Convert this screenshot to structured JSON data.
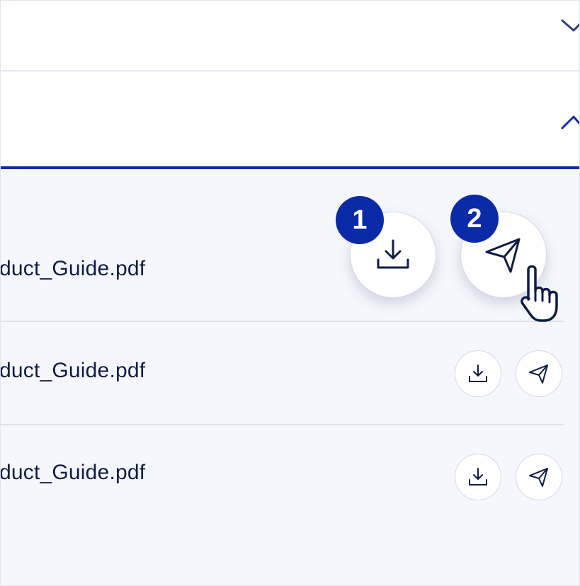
{
  "accordion": {
    "sections": [
      {
        "state": "collapsed",
        "icon": "chevron-down-icon"
      },
      {
        "state": "expanded",
        "icon": "chevron-up-icon"
      }
    ]
  },
  "files": [
    {
      "name": "duct_Guide.pdf",
      "download_icon": "download-icon",
      "send_icon": "send-icon"
    },
    {
      "name": "duct_Guide.pdf",
      "download_icon": "download-icon",
      "send_icon": "send-icon"
    },
    {
      "name": "duct_Guide.pdf",
      "download_icon": "download-icon",
      "send_icon": "send-icon"
    }
  ],
  "steps": [
    {
      "number": "1",
      "target": "download"
    },
    {
      "number": "2",
      "target": "send"
    }
  ],
  "colors": {
    "accent": "#0a2aa8",
    "text": "#0e1c47",
    "content_bg": "#f6f7fd",
    "divider": "#dfe2ec"
  },
  "cursor": {
    "icon": "hand-pointer-icon"
  }
}
